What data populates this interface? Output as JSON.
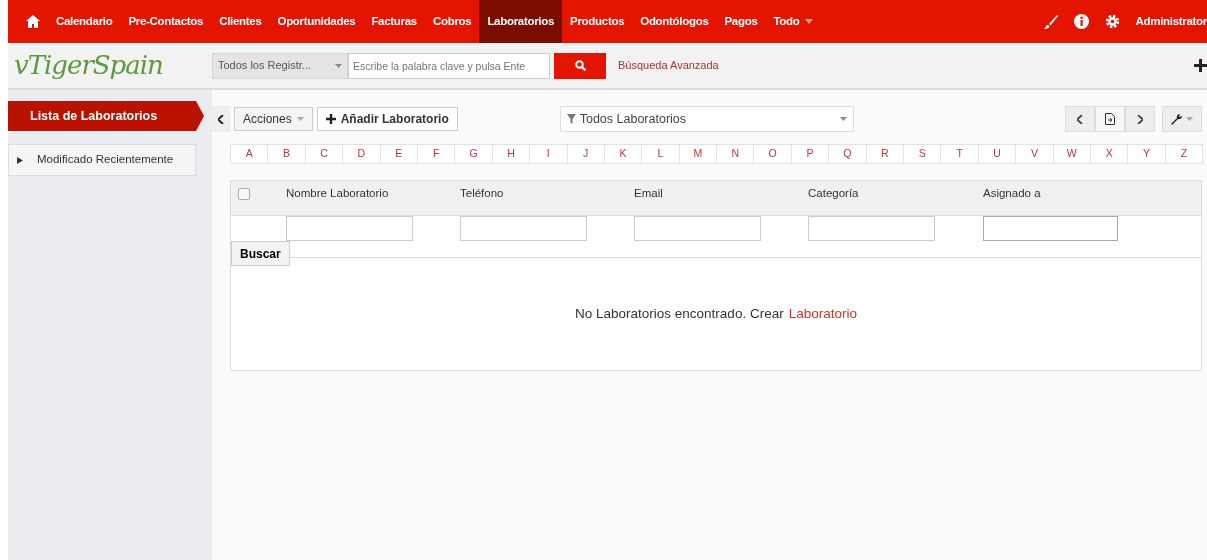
{
  "top_nav": {
    "items": [
      {
        "label": "Calendario",
        "selected": false
      },
      {
        "label": "Pre-Contactos",
        "selected": false
      },
      {
        "label": "Clientes",
        "selected": false
      },
      {
        "label": "Oportunidades",
        "selected": false
      },
      {
        "label": "Facturas",
        "selected": false
      },
      {
        "label": "Cobros",
        "selected": false
      },
      {
        "label": "Laboratorios",
        "selected": true
      },
      {
        "label": "Productos",
        "selected": false
      },
      {
        "label": "Odontólogos",
        "selected": false
      },
      {
        "label": "Pagos",
        "selected": false
      },
      {
        "label": "Todo",
        "selected": false,
        "kind": "dropdown"
      }
    ],
    "user": "Administrator"
  },
  "header": {
    "logo": "vTigerSpain",
    "search_scope": "Todos los Registr...",
    "search": {
      "placeholder": "Escribe la palabra clave y pulsa Ente"
    },
    "advanced_search": "Búsqueda Avanzada"
  },
  "sidebar": {
    "items": [
      {
        "label": "Lista de Laboratorios",
        "selected": true,
        "kind": "title"
      },
      {
        "label": "Modificado Recientemente",
        "selected": false,
        "expanded": false,
        "kind": "expander"
      }
    ]
  },
  "toolbar": {
    "actions": "Acciones",
    "add": "Añadir Laboratorio",
    "filter": "Todos Laboratorios"
  },
  "alphabet": [
    "A",
    "B",
    "C",
    "D",
    "E",
    "F",
    "G",
    "H",
    "I",
    "J",
    "K",
    "L",
    "M",
    "N",
    "O",
    "P",
    "Q",
    "R",
    "S",
    "T",
    "U",
    "V",
    "W",
    "X",
    "Y",
    "Z"
  ],
  "table": {
    "select_all_checked": false,
    "columns": [
      "Nombre Laboratorio",
      "Teléfono",
      "Email",
      "Categoría",
      "Asignado a"
    ],
    "search_button": "Buscar",
    "empty_message": "No Laboratorios encontrado. Crear",
    "empty_link": "Laboratorio"
  }
}
